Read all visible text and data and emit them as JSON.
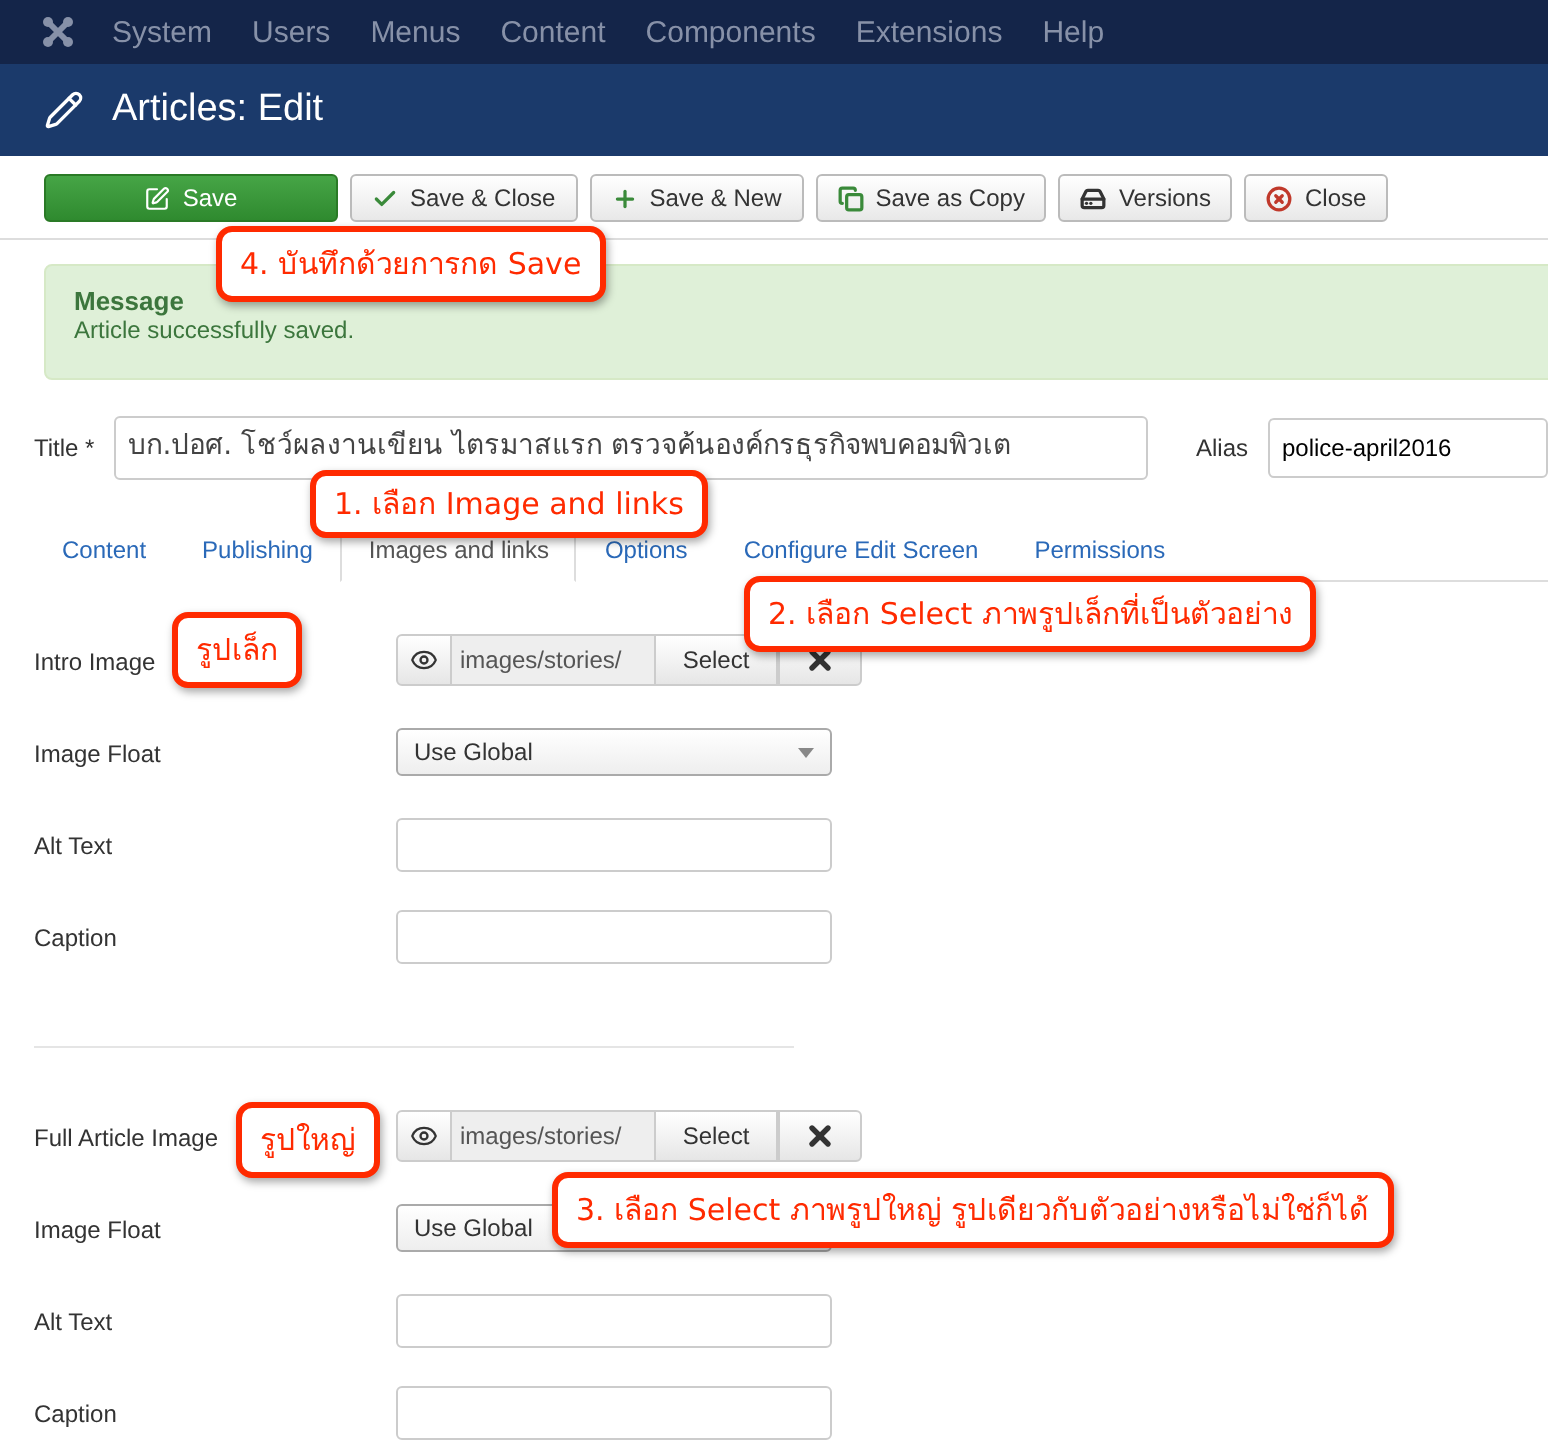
{
  "menu": [
    "System",
    "Users",
    "Menus",
    "Content",
    "Components",
    "Extensions",
    "Help"
  ],
  "header": {
    "title": "Articles: Edit"
  },
  "toolbar": [
    {
      "label": "Save",
      "kind": "save",
      "primary": true
    },
    {
      "label": "Save & Close",
      "kind": "check",
      "primary": false
    },
    {
      "label": "Save & New",
      "kind": "plus",
      "primary": false
    },
    {
      "label": "Save as Copy",
      "kind": "copy",
      "primary": false
    },
    {
      "label": "Versions",
      "kind": "versions",
      "primary": false
    },
    {
      "label": "Close",
      "kind": "close",
      "primary": false
    }
  ],
  "message": {
    "heading": "Message",
    "text": "Article successfully saved."
  },
  "title_field": {
    "label": "Title *",
    "value": "บก.ปอศ. โชว์ผลงานเขียน ไตรมาสแรก ตรวจค้นองค์กรธุรกิจพบคอมพิวเต"
  },
  "alias_field": {
    "label": "Alias",
    "value": "police-april2016"
  },
  "tabs": [
    {
      "label": "Content",
      "selected": false
    },
    {
      "label": "Publishing",
      "selected": false
    },
    {
      "label": "Images and links",
      "selected": true
    },
    {
      "label": "Options",
      "selected": false
    },
    {
      "label": "Configure Edit Screen",
      "selected": false
    },
    {
      "label": "Permissions",
      "selected": false
    }
  ],
  "sections": [
    {
      "fields": [
        {
          "label": "Intro Image",
          "kind": "media",
          "value": "images/stories/",
          "button": "Select"
        },
        {
          "label": "Image Float",
          "kind": "select",
          "value": "Use Global"
        },
        {
          "label": "Alt Text",
          "kind": "text"
        },
        {
          "label": "Caption",
          "kind": "text"
        }
      ]
    },
    {
      "fields": [
        {
          "label": "Full Article Image",
          "kind": "media",
          "value": "images/stories/",
          "button": "Select"
        },
        {
          "label": "Image Float",
          "kind": "select",
          "value": "Use Global"
        },
        {
          "label": "Alt Text",
          "kind": "text"
        },
        {
          "label": "Caption",
          "kind": "text"
        }
      ]
    }
  ],
  "callouts": [
    {
      "text": "4. บันทึกด้วยการกด Save"
    },
    {
      "text": "1. เลือก Image and links"
    },
    {
      "text": "2. เลือก Select ภาพรูปเล็กที่เป็นตัวอย่าง"
    },
    {
      "text": "รูปเล็ก"
    },
    {
      "text": "รูปใหญ่"
    },
    {
      "text": "3. เลือก Select ภาพรูปใหญ่ รูปเดียวกับตัวอย่างหรือไม่ใช่ก็ได้"
    }
  ]
}
